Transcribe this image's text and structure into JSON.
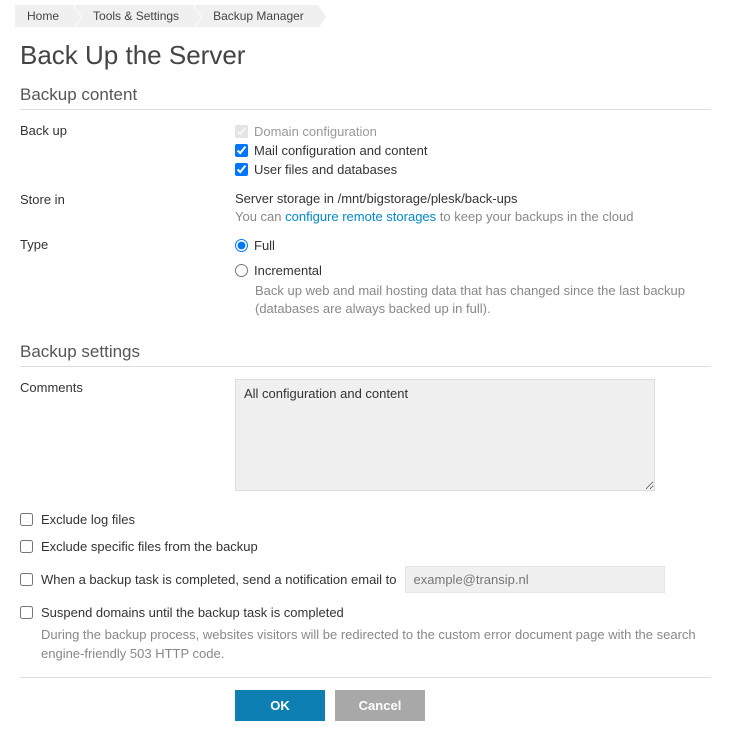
{
  "breadcrumb": [
    "Home",
    "Tools & Settings",
    "Backup Manager"
  ],
  "page_title": "Back Up the Server",
  "section_content": "Backup content",
  "section_settings": "Backup settings",
  "labels": {
    "backup": "Back up",
    "store_in": "Store in",
    "type": "Type",
    "comments": "Comments"
  },
  "backup_checks": {
    "domain": {
      "label": "Domain configuration",
      "checked": true,
      "disabled": true
    },
    "mail": {
      "label": "Mail configuration and content",
      "checked": true,
      "disabled": false
    },
    "users": {
      "label": "User files and databases",
      "checked": true,
      "disabled": false
    }
  },
  "store_in": {
    "line": "Server storage in /mnt/bigstorage/plesk/back-ups",
    "sub_prefix": "You can ",
    "link": "configure remote storages",
    "sub_suffix": " to keep your backups in the cloud"
  },
  "type": {
    "full": "Full",
    "incremental": "Incremental",
    "incremental_sub": "Back up web and mail hosting data that has changed since the last backup (databases are always backed up in full)."
  },
  "comments_value": "All configuration and content",
  "options": {
    "exclude_log": "Exclude log files",
    "exclude_files": "Exclude specific files from the backup",
    "notify": "When a backup task is completed, send a notification email to",
    "notify_placeholder": "example@transip.nl",
    "suspend": "Suspend domains until the backup task is completed",
    "suspend_sub": "During the backup process, websites visitors will be redirected to the custom error document page with the search engine-friendly 503 HTTP code."
  },
  "buttons": {
    "ok": "OK",
    "cancel": "Cancel"
  }
}
